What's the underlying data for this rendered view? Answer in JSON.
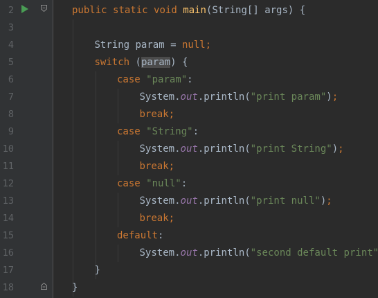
{
  "editor": {
    "line_numbers": [
      "2",
      "3",
      "4",
      "5",
      "6",
      "7",
      "8",
      "9",
      "10",
      "11",
      "12",
      "13",
      "14",
      "15",
      "16",
      "17",
      "18"
    ],
    "lines": [
      [
        {
          "t": "public ",
          "c": "kw"
        },
        {
          "t": "static ",
          "c": "kw"
        },
        {
          "t": "void ",
          "c": "kw"
        },
        {
          "t": "main",
          "c": "fn"
        },
        {
          "t": "(String[] args) {",
          "c": "plain"
        }
      ],
      [],
      [
        {
          "t": "String param = ",
          "c": "plain"
        },
        {
          "t": "null",
          "c": "kw"
        },
        {
          "t": ";",
          "c": "kw"
        }
      ],
      [
        {
          "t": "switch ",
          "c": "kw"
        },
        {
          "t": "(",
          "c": "plain"
        },
        {
          "t": "param",
          "c": "highlight"
        },
        {
          "t": ") {",
          "c": "plain"
        }
      ],
      [
        {
          "t": "case ",
          "c": "kw"
        },
        {
          "t": "\"param\"",
          "c": "str"
        },
        {
          "t": ":",
          "c": "plain"
        }
      ],
      [
        {
          "t": "System.",
          "c": "plain"
        },
        {
          "t": "out",
          "c": "fld"
        },
        {
          "t": ".println(",
          "c": "plain"
        },
        {
          "t": "\"print param\"",
          "c": "str"
        },
        {
          "t": ")",
          "c": "plain"
        },
        {
          "t": ";",
          "c": "kw"
        }
      ],
      [
        {
          "t": "break",
          "c": "kw"
        },
        {
          "t": ";",
          "c": "kw"
        }
      ],
      [
        {
          "t": "case ",
          "c": "kw"
        },
        {
          "t": "\"String\"",
          "c": "str"
        },
        {
          "t": ":",
          "c": "plain"
        }
      ],
      [
        {
          "t": "System.",
          "c": "plain"
        },
        {
          "t": "out",
          "c": "fld"
        },
        {
          "t": ".println(",
          "c": "plain"
        },
        {
          "t": "\"print String\"",
          "c": "str"
        },
        {
          "t": ")",
          "c": "plain"
        },
        {
          "t": ";",
          "c": "kw"
        }
      ],
      [
        {
          "t": "break",
          "c": "kw"
        },
        {
          "t": ";",
          "c": "kw"
        }
      ],
      [
        {
          "t": "case ",
          "c": "kw"
        },
        {
          "t": "\"null\"",
          "c": "str"
        },
        {
          "t": ":",
          "c": "plain"
        }
      ],
      [
        {
          "t": "System.",
          "c": "plain"
        },
        {
          "t": "out",
          "c": "fld"
        },
        {
          "t": ".println(",
          "c": "plain"
        },
        {
          "t": "\"print null\"",
          "c": "str"
        },
        {
          "t": ")",
          "c": "plain"
        },
        {
          "t": ";",
          "c": "kw"
        }
      ],
      [
        {
          "t": "break",
          "c": "kw"
        },
        {
          "t": ";",
          "c": "kw"
        }
      ],
      [
        {
          "t": "default",
          "c": "kw"
        },
        {
          "t": ":",
          "c": "plain"
        }
      ],
      [
        {
          "t": "System.",
          "c": "plain"
        },
        {
          "t": "out",
          "c": "fld"
        },
        {
          "t": ".println(",
          "c": "plain"
        },
        {
          "t": "\"second default print\"",
          "c": "str"
        },
        {
          "t": ")",
          "c": "plain"
        },
        {
          "t": ";",
          "c": "kw"
        }
      ],
      [
        {
          "t": "}",
          "c": "plain"
        }
      ],
      [
        {
          "t": "}",
          "c": "plain"
        }
      ]
    ],
    "indent_levels": [
      1,
      0,
      2,
      2,
      3,
      4,
      4,
      3,
      4,
      4,
      3,
      4,
      4,
      3,
      4,
      2,
      1
    ],
    "colors": {
      "background": "#2b2b2b",
      "gutter": "#313335",
      "keyword": "#cc7832",
      "method": "#ffc66d",
      "string": "#6a8759",
      "field": "#9876aa",
      "text": "#a9b7c6",
      "line_number": "#606366",
      "run_icon": "#499c54"
    },
    "icons": {
      "run": "run-gutter-icon",
      "fold_open": "fold-open-icon",
      "fold_close": "fold-close-icon"
    }
  }
}
